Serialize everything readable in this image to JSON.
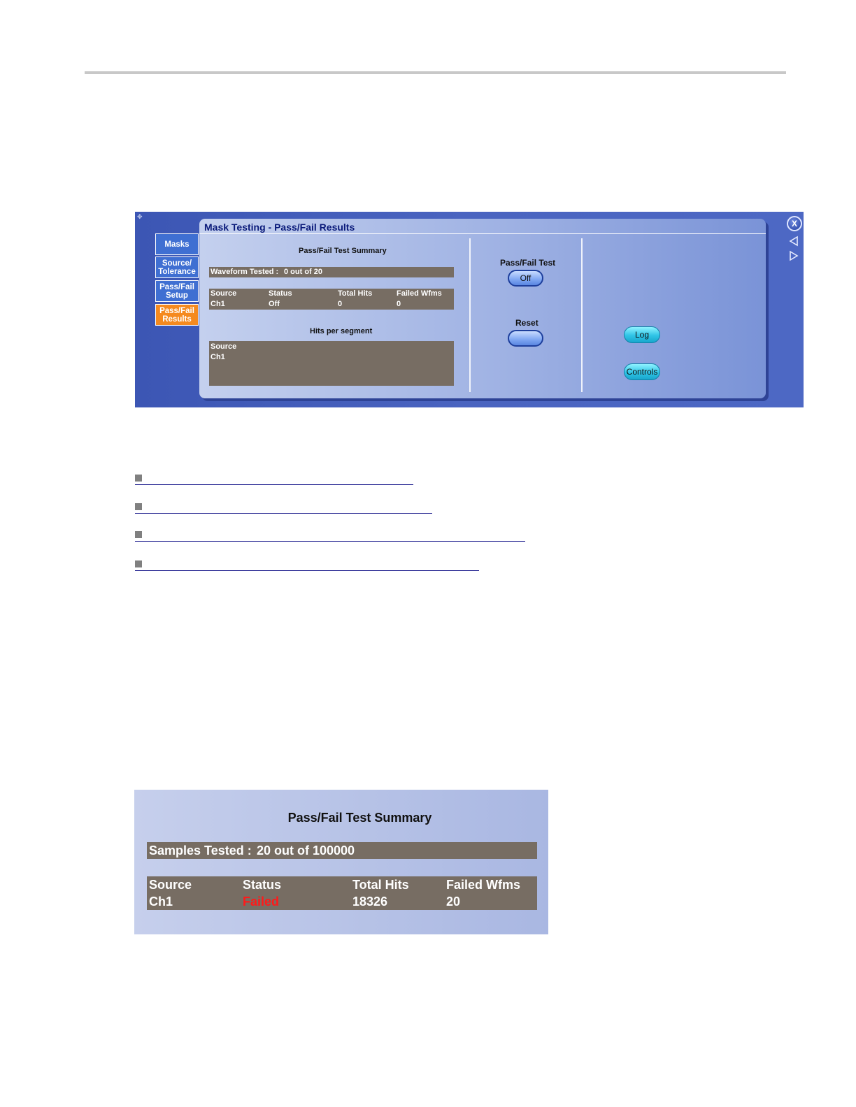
{
  "panel": {
    "title": "Mask Testing - Pass/Fail Results",
    "tabs": [
      {
        "label_line1": "Masks",
        "label_line2": ""
      },
      {
        "label_line1": "Source/",
        "label_line2": "Tolerance"
      },
      {
        "label_line1": "Pass/Fail",
        "label_line2": "Setup"
      },
      {
        "label_line1": "Pass/Fail",
        "label_line2": "Results"
      }
    ],
    "active_tab": 3,
    "summary_title": "Pass/Fail Test Summary",
    "waveform_tested_label": "Waveform Tested :",
    "waveform_tested_value": "0 out of 20",
    "table": {
      "headers": [
        "Source",
        "Status",
        "Total Hits",
        "Failed Wfms"
      ],
      "row": [
        "Ch1",
        "Off",
        "0",
        "0"
      ]
    },
    "hits_title": "Hits per segment",
    "hits_box": {
      "line1": "Source",
      "line2": "Ch1"
    },
    "pass_fail_test_label": "Pass/Fail Test",
    "pass_fail_test_value": "Off",
    "reset_label": "Reset",
    "log_label": "Log",
    "controls_label": "Controls",
    "close_label": "X"
  },
  "links_count": 4,
  "summary": {
    "title": "Pass/Fail Test Summary",
    "samples_label": "Samples Tested :",
    "samples_value": "20 out of 100000",
    "headers": [
      "Source",
      "Status",
      "Total Hits",
      "Failed Wfms"
    ],
    "row": [
      "Ch1",
      "Failed",
      "18326",
      "20"
    ],
    "failed_color": "#ff1a1a"
  },
  "colors": {
    "tab_active": "#f58a1f",
    "tab_inactive": "#3f6fd2",
    "grid_box": "#776d63"
  }
}
